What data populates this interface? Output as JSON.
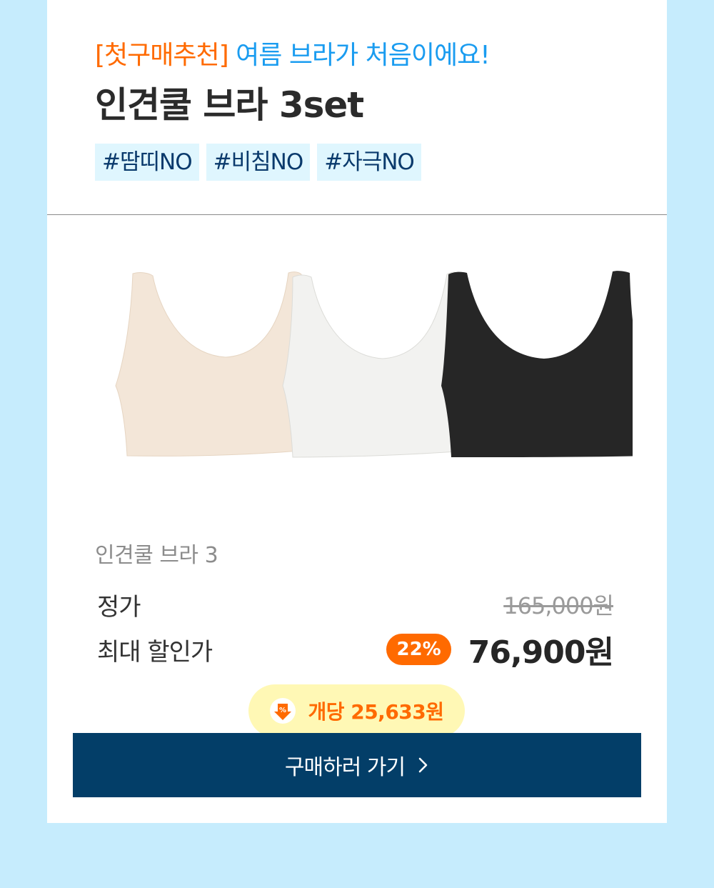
{
  "header": {
    "promo_tag": "[첫구매추천]",
    "promo_text": "여름 브라가 처음이에요!",
    "title": "인견쿨 브라 3set",
    "hashtags": [
      "#땀띠NO",
      "#비침NO",
      "#자극NO"
    ]
  },
  "product": {
    "name": "인견쿨 브라 3",
    "image_icon": "bra-3-colors-image",
    "colors": [
      "#f3e6d8",
      "#f2f2f0",
      "#262626"
    ]
  },
  "pricing": {
    "regular_label": "정가",
    "regular_price": "165,000원",
    "sale_label": "최대 할인가",
    "discount": "22%",
    "sale_price": "76,900원",
    "per_unit": "개당 25,633원",
    "per_unit_icon": "discount-down-arrow-icon"
  },
  "cta": {
    "label": "구매하러 가기",
    "icon": "chevron-right-icon"
  },
  "colors": {
    "accent_orange": "#ff6a00",
    "accent_blue": "#1a9cf0",
    "button_navy": "#033e68",
    "background": "#c6ecfd",
    "tooltip_yellow": "#fff8b5"
  }
}
